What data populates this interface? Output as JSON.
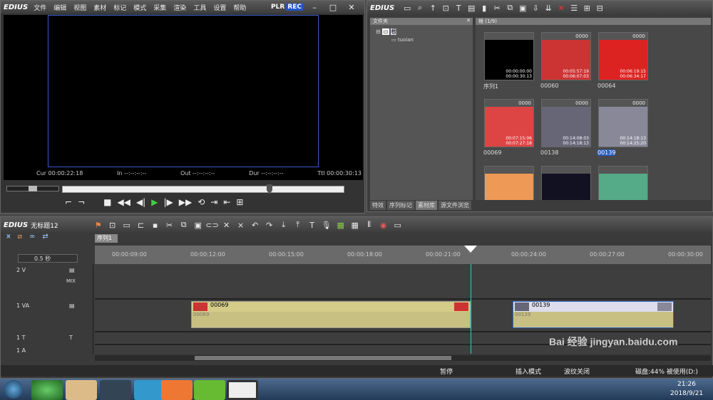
{
  "player": {
    "logo": "EDIUS",
    "menu": [
      "文件",
      "编辑",
      "视图",
      "素材",
      "标记",
      "模式",
      "采集",
      "渲染",
      "工具",
      "设置",
      "帮助"
    ],
    "plr": "PLR",
    "rec": "REC",
    "cur": "Cur 00:00:22:18",
    "in": "In --:--:--:--",
    "out": "Out --:--:--:--",
    "dur": "Dur --:--:--:--",
    "ttl": "Ttl 00:00:30:13"
  },
  "bin": {
    "logo": "EDIUS",
    "folder_title": "文件夹",
    "root": "根",
    "sub": "tuoian",
    "clip_title": "根 (1/9)",
    "tabs": [
      "特效",
      "序列标记",
      "素材库",
      "源文件浏览"
    ],
    "clips": [
      {
        "name": "序列1",
        "badge": "",
        "tc1": "00:00:00:00",
        "tc2": "00:00:30:13",
        "color": "#000"
      },
      {
        "name": "00060",
        "badge": "0000",
        "tc1": "00:05:57:19",
        "tc2": "00:06:07:03",
        "color": "#c33"
      },
      {
        "name": "00064",
        "badge": "0000",
        "tc1": "00:06:19:15",
        "tc2": "00:06:34:17",
        "color": "#d22"
      },
      {
        "name": "00069",
        "badge": "0000",
        "tc1": "00:07:15:06",
        "tc2": "00:07:27:18",
        "color": "#d44"
      },
      {
        "name": "00138",
        "badge": "0000",
        "tc1": "00:14:08:03",
        "tc2": "00:14:18:13",
        "color": "#667"
      },
      {
        "name": "00139",
        "badge": "0000",
        "tc1": "00:14:18:13",
        "tc2": "00:14:25:20",
        "color": "#889"
      },
      {
        "name": "",
        "badge": "",
        "tc1": "",
        "tc2": "",
        "color": "#e95"
      },
      {
        "name": "",
        "badge": "",
        "tc1": "",
        "tc2": "",
        "color": "#112"
      },
      {
        "name": "",
        "badge": "",
        "tc1": "",
        "tc2": "",
        "color": "#5a8"
      }
    ]
  },
  "timeline": {
    "logo": "EDIUS",
    "project": "无标题12",
    "seq_tab": "序列1",
    "zoom": "0.5 秒",
    "ticks": [
      "00:00:09:00",
      "00:00:12:00",
      "00:00:15:00",
      "00:00:18:00",
      "00:00:21:00",
      "00:00:24:00",
      "00:00:27:00",
      "00:00:30:00"
    ],
    "tracks": {
      "v2": "2 V",
      "va1": "1 VA",
      "t1": "1 T",
      "a1": "1 A",
      "mix": "MIX"
    },
    "clip1": "00069",
    "clip1b": "00069",
    "clip2": "00139",
    "clip2b": "00139"
  },
  "status": {
    "pause": "暂停",
    "insert": "插入模式",
    "ripple": "波纹关闭",
    "disk": "磁盘:44% 被使用(D:)"
  },
  "taskbar": {
    "time": "21:26",
    "date": "2018/9/21"
  },
  "watermark": "Bai 经验 jingyan.baidu.com"
}
